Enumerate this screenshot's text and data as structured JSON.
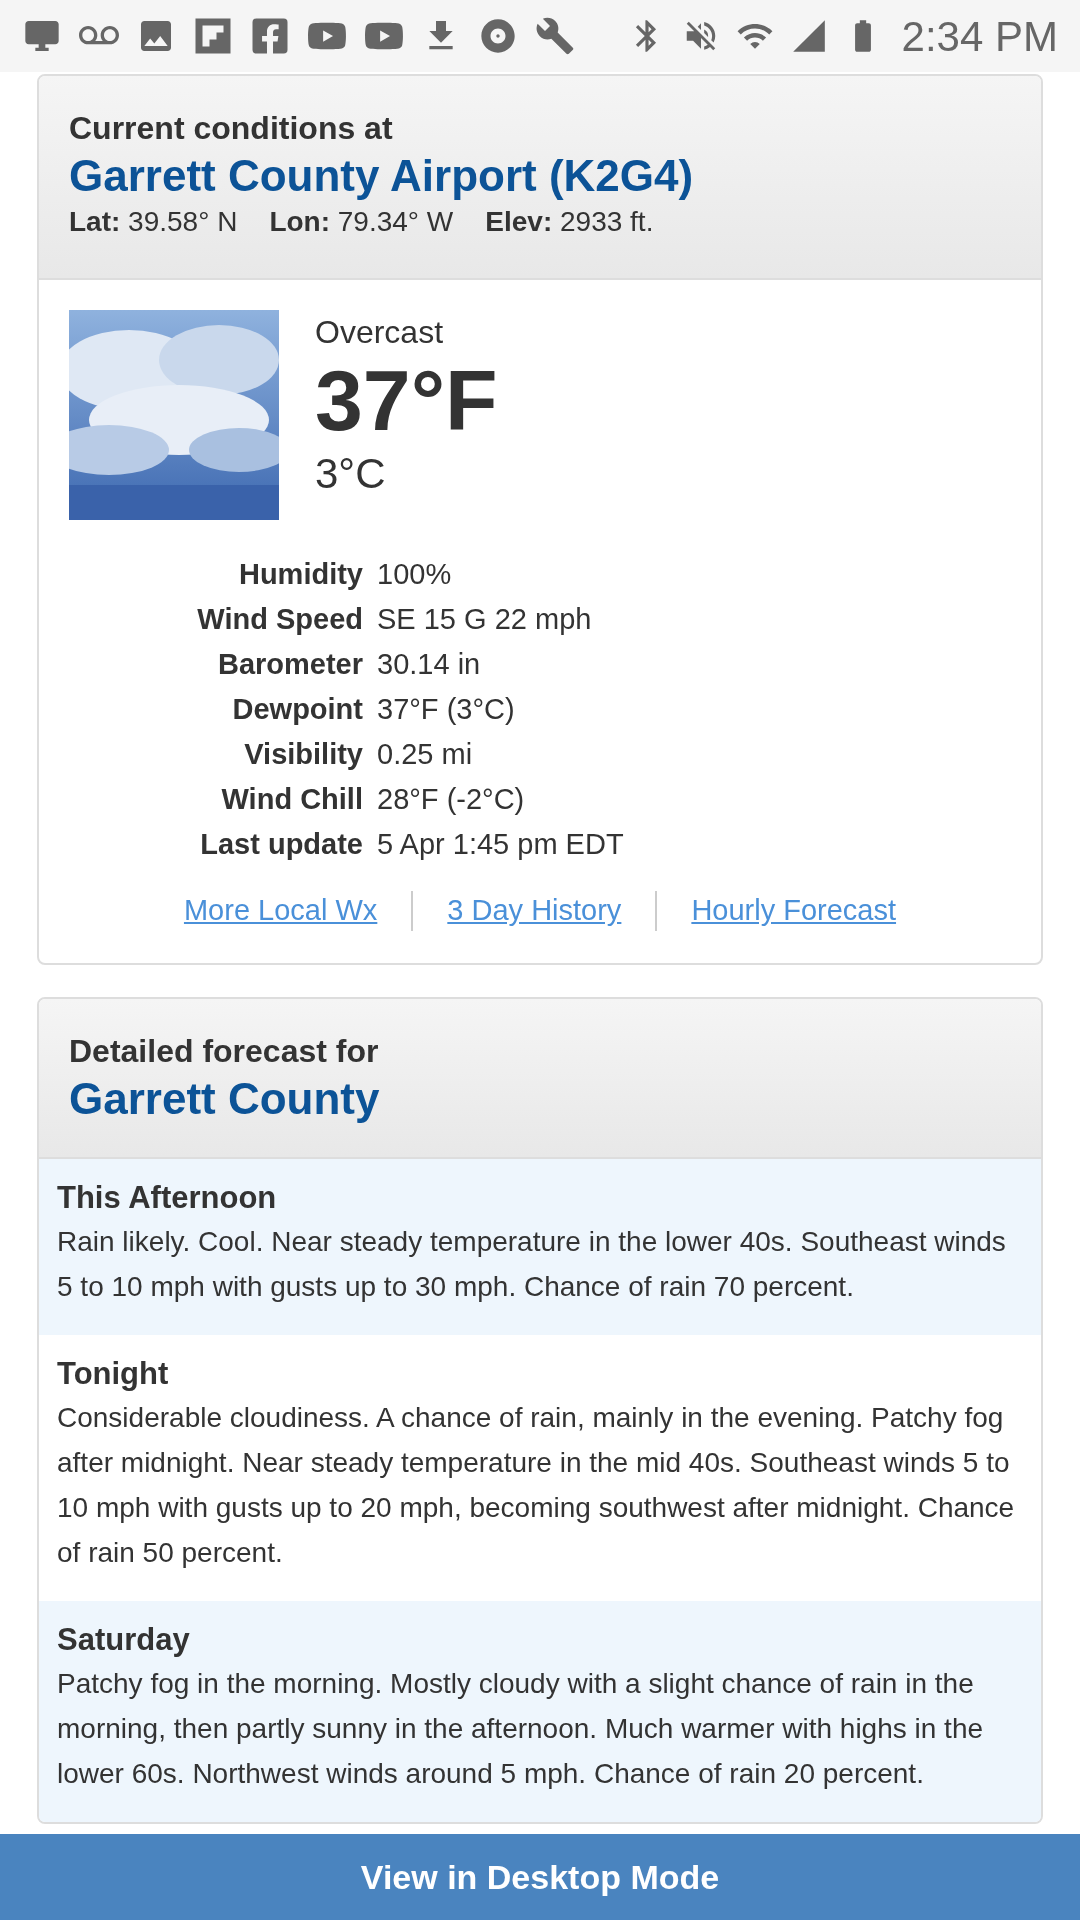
{
  "status_bar": {
    "time": "2:34 PM"
  },
  "conditions": {
    "heading": "Current conditions at",
    "station": "Garrett County Airport (K2G4)",
    "coords": [
      {
        "label": "Lat:",
        "value": "39.58° N"
      },
      {
        "label": "Lon:",
        "value": "79.34° W"
      },
      {
        "label": "Elev:",
        "value": "2933 ft."
      }
    ],
    "condition": "Overcast",
    "temp_f": "37°F",
    "temp_c": "3°C",
    "details": [
      {
        "label": "Humidity",
        "value": "100%"
      },
      {
        "label": "Wind Speed",
        "value": "SE 15 G 22 mph"
      },
      {
        "label": "Barometer",
        "value": "30.14 in"
      },
      {
        "label": "Dewpoint",
        "value": "37°F (3°C)"
      },
      {
        "label": "Visibility",
        "value": "0.25 mi"
      },
      {
        "label": "Wind Chill",
        "value": "28°F (-2°C)"
      },
      {
        "label": "Last update",
        "value": "5 Apr 1:45 pm EDT"
      }
    ],
    "links": [
      "More Local Wx",
      "3 Day History",
      "Hourly Forecast"
    ]
  },
  "forecast": {
    "heading": "Detailed forecast for",
    "location": "Garrett County",
    "periods": [
      {
        "name": "This Afternoon",
        "text": "Rain likely. Cool. Near steady temperature in the lower 40s. Southeast winds 5 to 10 mph with gusts up to 30 mph. Chance of rain 70 percent."
      },
      {
        "name": "Tonight",
        "text": "Considerable cloudiness. A chance of rain, mainly in the evening. Patchy fog after midnight. Near steady temperature in the mid 40s. Southeast winds 5 to 10 mph with gusts up to 20 mph, becoming southwest after midnight. Chance of rain 50 percent."
      },
      {
        "name": "Saturday",
        "text": "Patchy fog in the morning. Mostly cloudy with a slight chance of rain in the morning, then partly sunny in the afternoon. Much warmer with highs in the lower 60s. Northwest winds around 5 mph. Chance of rain 20 percent."
      }
    ]
  },
  "bottom_bar": {
    "label": "View in Desktop Mode"
  }
}
